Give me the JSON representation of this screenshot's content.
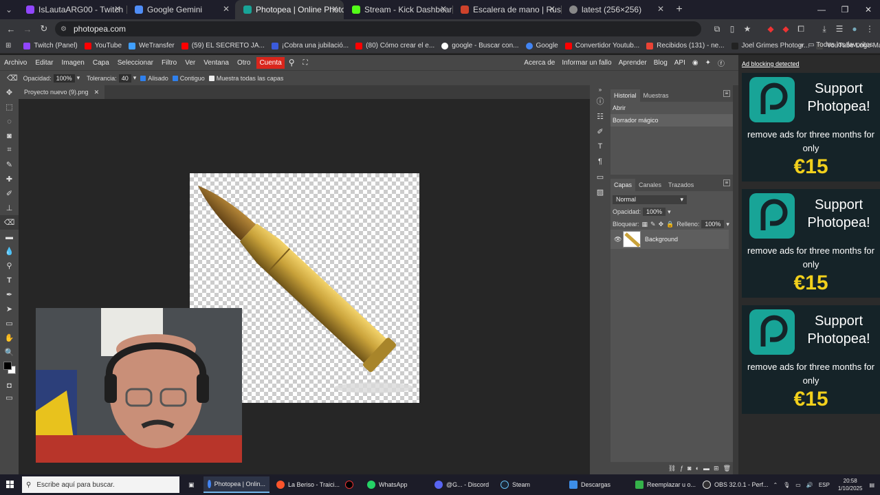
{
  "browser": {
    "tabs": [
      {
        "label": "IsLautaARG00 - Twitch",
        "color": "#9146ff"
      },
      {
        "label": "Google Gemini",
        "color": "#4f8df7"
      },
      {
        "label": "Photopea | Online Photo Editor",
        "color": "#18a497"
      },
      {
        "label": "Stream - Kick Dashboard",
        "color": "#53fc18"
      },
      {
        "label": "Escalera de mano | Rust Wiki",
        "color": "#ce422b"
      },
      {
        "label": "latest (256×256)",
        "color": "#888888"
      }
    ],
    "active_tab": 2,
    "url": "photopea.com",
    "bookmarks": [
      {
        "label": "Twitch (Panel)",
        "color": "#9146ff"
      },
      {
        "label": "YouTube",
        "color": "#ff0000"
      },
      {
        "label": "WeTransfer",
        "color": "#409fff"
      },
      {
        "label": "(59) EL SECRETO JA...",
        "color": "#ff0000"
      },
      {
        "label": "¡Cobra una jubilació...",
        "color": "#3b5bdb"
      },
      {
        "label": "(80) Cómo crear el e...",
        "color": "#ff0000"
      },
      {
        "label": "google - Buscar con...",
        "color": "#ffffff"
      },
      {
        "label": "Google",
        "color": "#4285f4"
      },
      {
        "label": "Convertidor Youtub...",
        "color": "#ff0000"
      },
      {
        "label": "Recibidos (131) - ne...",
        "color": "#ea4335"
      },
      {
        "label": "Joel Grimes Photogr...",
        "color": "#222222"
      },
      {
        "label": "YouTube Logo Mak...",
        "color": "#444444"
      }
    ],
    "all_bookmarks": "Todos los favoritos"
  },
  "photopea": {
    "menu": [
      "Archivo",
      "Editar",
      "Imagen",
      "Capa",
      "Seleccionar",
      "Filtro",
      "Ver",
      "Ventana",
      "Otro"
    ],
    "account": "Cuenta",
    "menu_right": [
      "Acerca de",
      "Informar un fallo",
      "Aprender",
      "Blog",
      "API"
    ],
    "options": {
      "opacity_label": "Opacidad:",
      "opacity": "100%",
      "tolerance_label": "Tolerancia:",
      "tolerance": "40",
      "antialias": "Alisado",
      "contiguous": "Contiguo",
      "sample_all": "Muestra todas las capas"
    },
    "document_tab": "Proyecto nuevo (9).png",
    "history": {
      "tabs": [
        "Historial",
        "Muestras"
      ],
      "items": [
        "Abrir",
        "Borrador mágico"
      ]
    },
    "layers": {
      "tabs": [
        "Capas",
        "Canales",
        "Trazados"
      ],
      "blend_mode": "Normal",
      "opacity_label": "Opacidad:",
      "opacity": "100%",
      "lock_label": "Bloquear:",
      "fill_label": "Relleno:",
      "fill": "100%",
      "layer_name": "Background"
    }
  },
  "ads": {
    "blocking_label": "Ad blocking detected",
    "title": "Support Photopea!",
    "subtitle": "remove ads for three months for only",
    "price": "€15"
  },
  "taskbar": {
    "search_placeholder": "Escribe aquí para buscar.",
    "apps": [
      {
        "label": "Photopea | Onlin...",
        "color": "#4285f4"
      },
      {
        "label": "La Beriso - Traici...",
        "color": "#fb542b"
      },
      {
        "label": "",
        "color": "#000000"
      },
      {
        "label": "WhatsApp",
        "color": "#25d366"
      },
      {
        "label": "@G... - Discord",
        "color": "#5865f2"
      },
      {
        "label": "Steam",
        "color": "#1b2838"
      },
      {
        "label": "Descargas",
        "color": "#3d8ee8"
      },
      {
        "label": "Reemplazar u o...",
        "color": "#35b24a"
      },
      {
        "label": "OBS 32.0.1 - Perf...",
        "color": "#302e31"
      }
    ],
    "language": "ESP",
    "time": "20:58",
    "date": "1/10/2025"
  }
}
